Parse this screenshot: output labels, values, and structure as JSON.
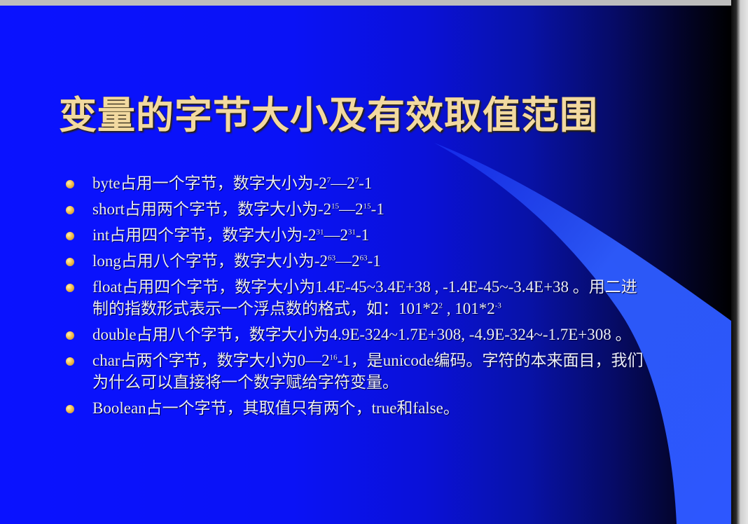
{
  "slide": {
    "title": "变量的字节大小及有效取值范围",
    "bullets": [
      {
        "segments": [
          {
            "t": "byte占用一个字节，数字大小为-2"
          },
          {
            "t": "7",
            "sup": true
          },
          {
            "t": "—2"
          },
          {
            "t": "7",
            "sup": true
          },
          {
            "t": "-1"
          }
        ]
      },
      {
        "segments": [
          {
            "t": "short占用两个字节，数字大小为-2"
          },
          {
            "t": "15",
            "sup": true
          },
          {
            "t": "—2"
          },
          {
            "t": "15",
            "sup": true
          },
          {
            "t": "-1"
          }
        ]
      },
      {
        "segments": [
          {
            "t": "int占用四个字节，数字大小为-2"
          },
          {
            "t": "31",
            "sup": true
          },
          {
            "t": "—2"
          },
          {
            "t": "31",
            "sup": true
          },
          {
            "t": "-1"
          }
        ]
      },
      {
        "segments": [
          {
            "t": "long占用八个字节，数字大小为-2"
          },
          {
            "t": "63",
            "sup": true
          },
          {
            "t": "—2"
          },
          {
            "t": "63",
            "sup": true
          },
          {
            "t": "-1"
          }
        ]
      },
      {
        "segments": [
          {
            "t": "float占用四个字节，数字大小为1.4E-45~3.4E+38 , -1.4E-45~-3.4E+38 。用二进制的指数形式表示一个浮点数的格式，如：101*2"
          },
          {
            "t": "2",
            "sup": true
          },
          {
            "t": " , 101*2"
          },
          {
            "t": "-3",
            "sup": true
          }
        ]
      },
      {
        "segments": [
          {
            "t": "double占用八个字节，数字大小为4.9E-324~1.7E+308, -4.9E-324~-1.7E+308 。"
          }
        ]
      },
      {
        "segments": [
          {
            "t": "char占两个字节，数字大小为0—2"
          },
          {
            "t": "16",
            "sup": true
          },
          {
            "t": "-1，是unicode编码。字符的本来面目，我们为什么可以直接将一个数字赋给字符变量。"
          }
        ]
      },
      {
        "segments": [
          {
            "t": "Boolean占一个字节，其取值只有两个，true和false。"
          }
        ]
      }
    ]
  },
  "colors": {
    "title": "#f2d9a0",
    "body_text": "#e9ecf8",
    "bullet": "#f4c050",
    "background_left": "#0a12ff",
    "background_right": "#000000",
    "swoosh": "#2e5cff"
  }
}
